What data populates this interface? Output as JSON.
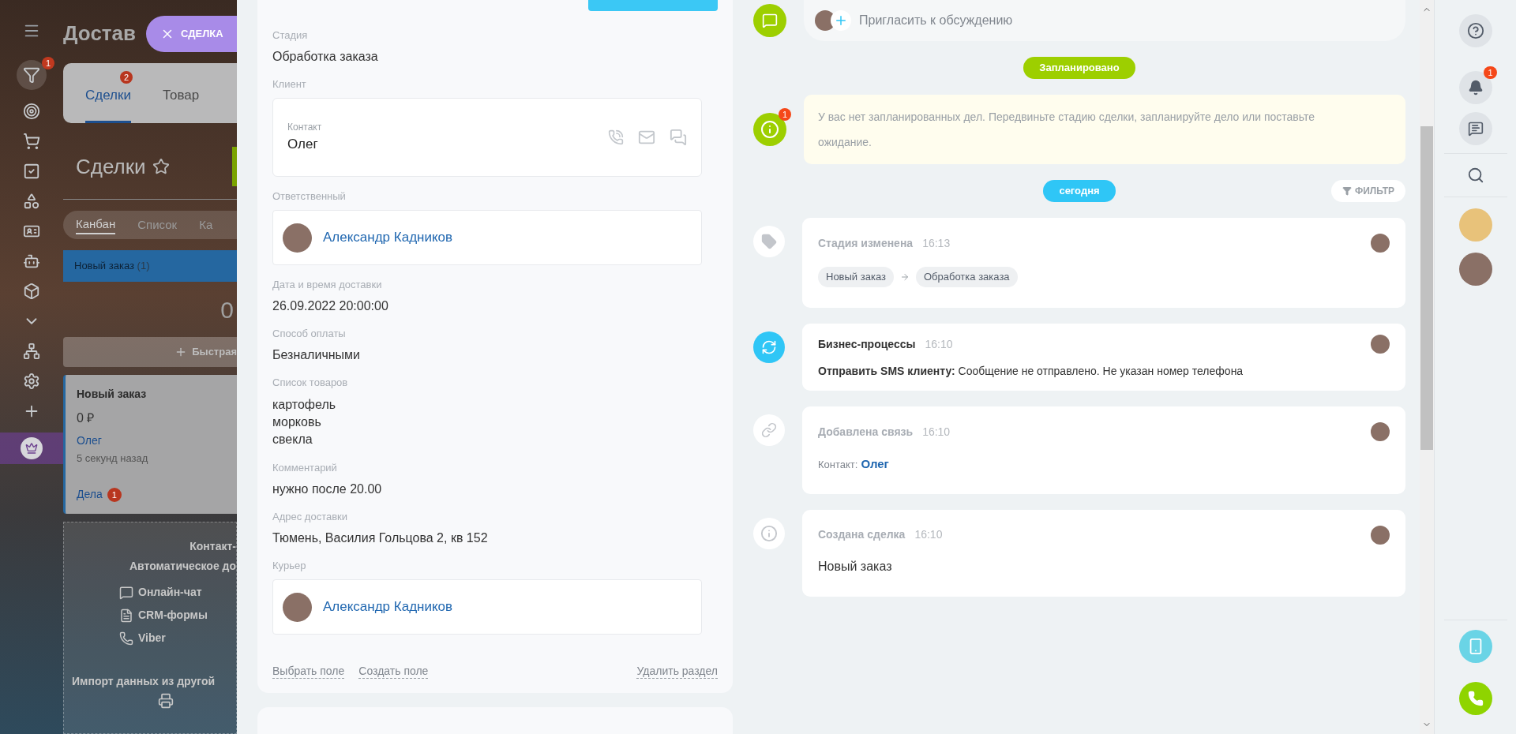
{
  "background": {
    "title": "Достав",
    "close_button": "СДЕЛКА",
    "tabs": [
      {
        "label": "Сделки",
        "badge": "2",
        "selected": true
      },
      {
        "label": "Товар",
        "selected": false
      }
    ],
    "heading": "Сделки",
    "views": [
      {
        "label": "Канбан",
        "selected": true
      },
      {
        "label": "Список",
        "selected": false
      },
      {
        "label": "Ка",
        "selected": false
      }
    ],
    "column": {
      "title": "Новый заказ",
      "count": "(1)",
      "total": "0",
      "quick_add": "Быстрая"
    },
    "deal_card": {
      "title": "Новый заказ",
      "amount": "0 ₽",
      "contact": "Олег",
      "time": "5 секунд назад",
      "activities": "Дела",
      "activities_badge": "1"
    },
    "promo": {
      "title": "Контакт-",
      "subtitle": "Автоматическое до",
      "channels": [
        {
          "kind": "chat",
          "label": "Онлайн-чат"
        },
        {
          "kind": "form",
          "label": "CRM-формы"
        },
        {
          "kind": "viber",
          "label": "Viber"
        }
      ],
      "import": "Импорт данных из другой"
    }
  },
  "left_nav": [
    {
      "kind": "filter",
      "badge": "1"
    },
    {
      "kind": "target"
    },
    {
      "kind": "cart"
    },
    {
      "kind": "task"
    },
    {
      "kind": "shapes"
    },
    {
      "kind": "card"
    },
    {
      "kind": "bot"
    },
    {
      "kind": "box"
    },
    {
      "kind": "more"
    },
    {
      "kind": "network"
    },
    {
      "kind": "settings"
    },
    {
      "kind": "plus"
    },
    {
      "kind": "crown"
    }
  ],
  "form": {
    "fields": [
      {
        "kind": "text",
        "label": "Стадия",
        "value": "Обработка заказа"
      },
      {
        "kind": "contact",
        "label": "Клиент",
        "sub_label": "Контакт",
        "value": "Олег"
      },
      {
        "kind": "user",
        "label": "Ответственный",
        "value": "Александр Кадников"
      },
      {
        "kind": "text",
        "label": "Дата и время доставки",
        "value": "26.09.2022 20:00:00"
      },
      {
        "kind": "text",
        "label": "Способ оплаты",
        "value": "Безналичными"
      },
      {
        "kind": "lines",
        "label": "Список товаров",
        "lines": [
          "картофель",
          "морковь",
          "свекла"
        ]
      },
      {
        "kind": "text",
        "label": "Комментарий",
        "value": "нужно после 20.00"
      },
      {
        "kind": "text",
        "label": "Адрес доставки",
        "value": "Тюмень, Василия Гольцова 2, кв 152"
      },
      {
        "kind": "user",
        "label": "Курьер",
        "value": "Александр Кадников"
      }
    ],
    "links": [
      "Выбрать поле",
      "Создать поле"
    ],
    "delete_link": "Удалить раздел"
  },
  "timeline": {
    "invite_placeholder": "Пригласить к обсуждению",
    "planned_label": "Запланировано",
    "notice": {
      "badge": "1",
      "text": "У вас нет запланированных дел. Передвиньте стадию сделки, запланируйте дело или поставьте ожидание."
    },
    "today_label": "сегодня",
    "filter_button": "ФИЛЬТР",
    "events": [
      {
        "kind": "stage",
        "title": "Стадия изменена",
        "time": "16:13",
        "from": "Новый заказ",
        "to": "Обработка заказа"
      },
      {
        "kind": "process",
        "title": "Бизнес-процессы",
        "time": "16:10",
        "text": "**Отправить SMS клиенту:** Сообщение не отправлено. Не указан номер телефона"
      },
      {
        "kind": "link",
        "title": "Добавлена связь",
        "time": "16:10",
        "label": "Контакт:",
        "link": "Олег"
      },
      {
        "kind": "created",
        "title": "Создана сделка",
        "time": "16:10",
        "text": "Новый заказ"
      }
    ]
  },
  "right_bar": {
    "notifications_badge": "1"
  }
}
